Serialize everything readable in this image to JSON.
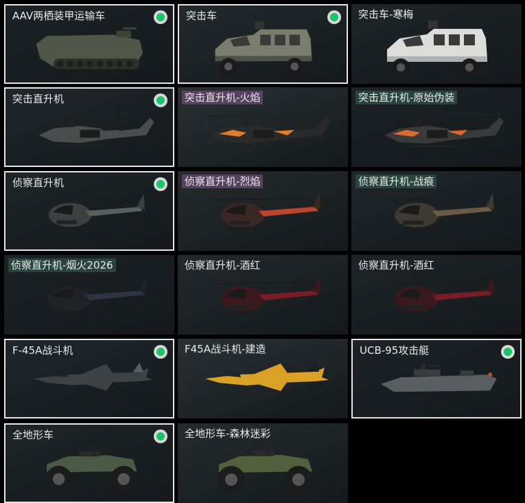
{
  "colors": {
    "accent_green": "#19c46a",
    "border_selected": "#e6e6e6",
    "text": "#eaeaea"
  },
  "cards": [
    {
      "label": "AAV两栖装甲运输车",
      "equipped": true,
      "selected": true,
      "skin": "none",
      "icon": "amphibious-tank"
    },
    {
      "label": "突击车",
      "equipped": true,
      "selected": true,
      "skin": "none",
      "icon": "armored-truck"
    },
    {
      "label": "突击车-寒梅",
      "equipped": false,
      "selected": false,
      "skin": "none",
      "icon": "armored-truck-white"
    },
    {
      "label": "突击直升机",
      "equipped": true,
      "selected": true,
      "skin": "none",
      "icon": "attack-helicopter"
    },
    {
      "label": "突击直升机-火焰",
      "equipped": false,
      "selected": false,
      "skin": "purple",
      "icon": "attack-helicopter-flame"
    },
    {
      "label": "突击直升机-原始伪装",
      "equipped": false,
      "selected": false,
      "skin": "green",
      "icon": "attack-helicopter-camo"
    },
    {
      "label": "侦察直升机",
      "equipped": true,
      "selected": true,
      "skin": "none",
      "icon": "scout-helicopter"
    },
    {
      "label": "侦察直升机-烈焰",
      "equipped": false,
      "selected": false,
      "skin": "purple",
      "icon": "scout-helicopter-blaze"
    },
    {
      "label": "侦察直升机-战痕",
      "equipped": false,
      "selected": false,
      "skin": "green",
      "icon": "scout-helicopter-scar"
    },
    {
      "label": "侦察直升机-烟火2026",
      "equipped": false,
      "selected": false,
      "skin": "green",
      "icon": "scout-helicopter-firework"
    },
    {
      "label": "侦察直升机-酒红",
      "equipped": false,
      "selected": false,
      "skin": "none",
      "icon": "scout-helicopter-wine"
    },
    {
      "label": "侦察直升机-酒红",
      "equipped": false,
      "selected": false,
      "skin": "none",
      "icon": "scout-helicopter-wine"
    },
    {
      "label": "F-45A战斗机",
      "equipped": true,
      "selected": true,
      "skin": "none",
      "icon": "fighter-jet"
    },
    {
      "label": "F45A战斗机-建造",
      "equipped": false,
      "selected": false,
      "skin": "none",
      "icon": "fighter-jet-construction"
    },
    {
      "label": "UCB-95攻击艇",
      "equipped": true,
      "selected": true,
      "skin": "none",
      "icon": "attack-boat"
    },
    {
      "label": "全地形车",
      "equipped": true,
      "selected": true,
      "skin": "none",
      "icon": "atv"
    },
    {
      "label": "全地形车-森林迷彩",
      "equipped": false,
      "selected": false,
      "skin": "none",
      "icon": "atv-forest-camo"
    }
  ]
}
